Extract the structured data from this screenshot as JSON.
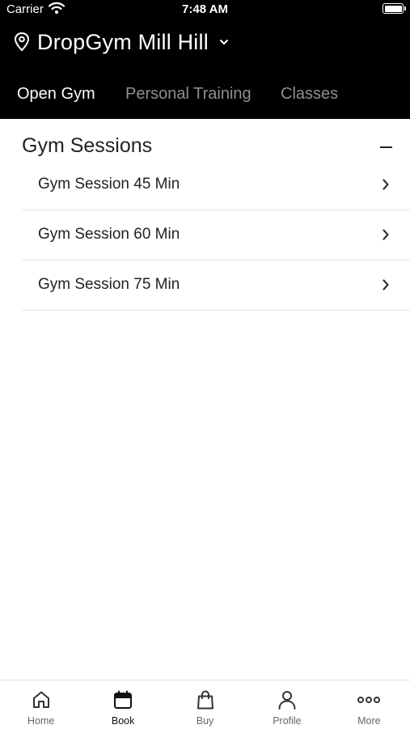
{
  "status_bar": {
    "carrier": "Carrier",
    "time": "7:48 AM"
  },
  "header": {
    "location": "DropGym Mill Hill",
    "tabs": [
      {
        "label": "Open Gym",
        "active": true
      },
      {
        "label": "Personal Training",
        "active": false
      },
      {
        "label": "Classes",
        "active": false
      }
    ]
  },
  "section": {
    "title": "Gym Sessions",
    "items": [
      {
        "label": "Gym Session 45 Min"
      },
      {
        "label": "Gym Session 60 Min"
      },
      {
        "label": "Gym Session 75 Min"
      }
    ]
  },
  "tab_bar": {
    "items": [
      {
        "label": "Home",
        "icon": "home-icon"
      },
      {
        "label": "Book",
        "icon": "calendar-icon",
        "active": true
      },
      {
        "label": "Buy",
        "icon": "shopping-bag-icon"
      },
      {
        "label": "Profile",
        "icon": "person-icon"
      },
      {
        "label": "More",
        "icon": "more-dots-icon"
      }
    ]
  },
  "colors": {
    "header_bg": "#000000",
    "active_tab": "#ffffff",
    "inactive_tab": "#8e8e8e"
  }
}
